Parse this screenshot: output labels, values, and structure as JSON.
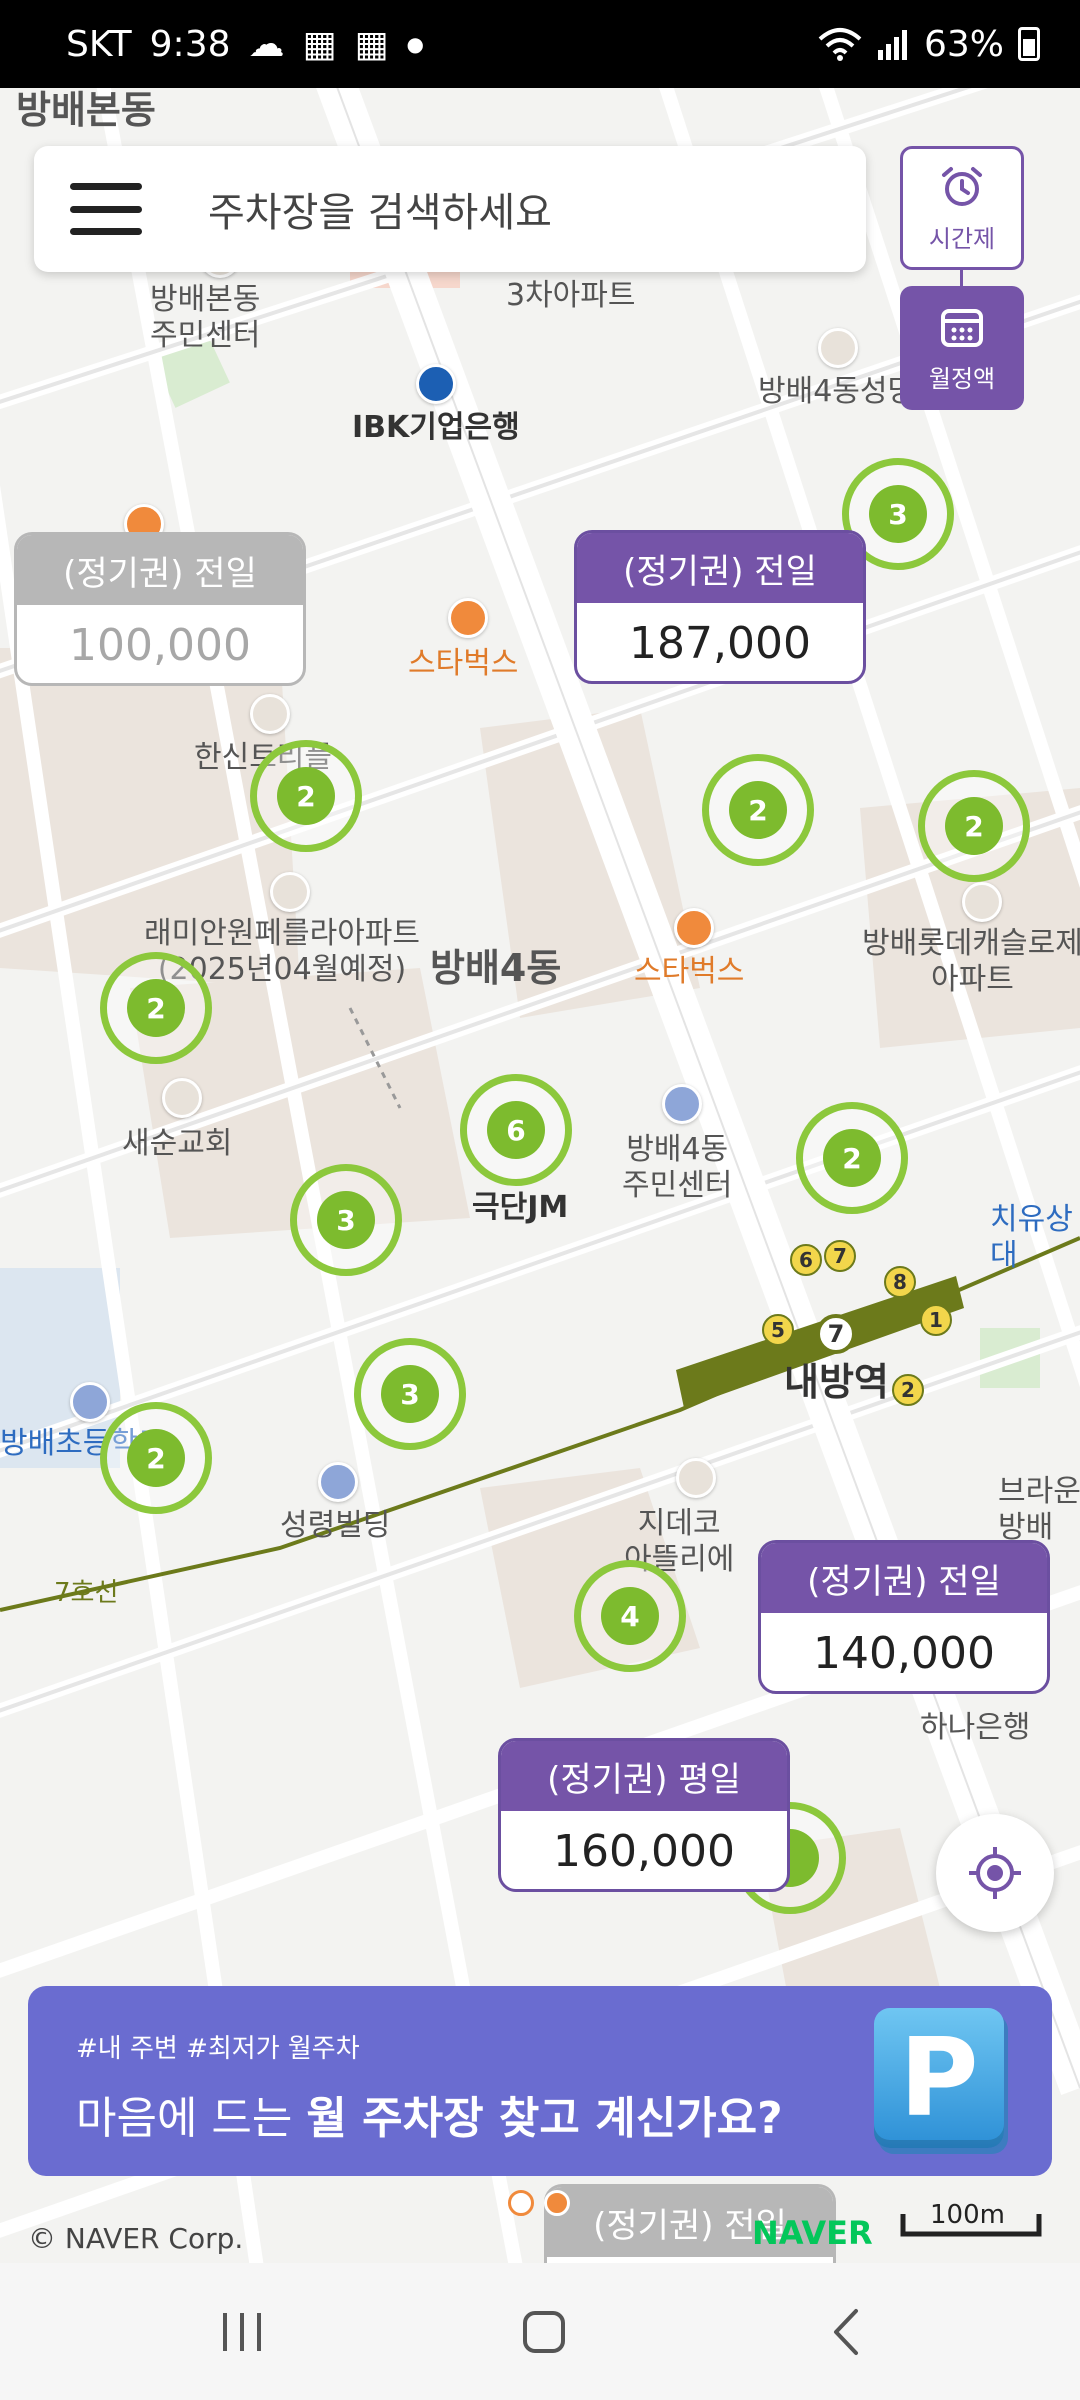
{
  "status_bar": {
    "carrier": "SKT",
    "time": "9:38",
    "battery": "63%"
  },
  "search": {
    "placeholder": "주차장을 검색하세요"
  },
  "mode_buttons": {
    "hourly_label": "시간제",
    "monthly_label": "월정액"
  },
  "map_labels": {
    "area_top": "방배본동",
    "center_top": "방배본동\n주민센터",
    "apt3": "3차아파트",
    "ibk": "IBK기업은행",
    "bangbae4_sung": "방배4동성당",
    "starbucks1": "스타벅스",
    "starbucks2": "스타벅스",
    "hansin": "한신트리플",
    "raemian": "래미안원페를라아파트\n(2025년04월예정)",
    "bangbae4": "방배4동",
    "lotte": "방배롯데캐슬로제\n아파트",
    "saesoon": "새순교회",
    "gukdan": "극단JM",
    "center4": "방배4동\n주민센터",
    "naebang": "내방역",
    "school": "방배초등학교",
    "seongnyeong": "성령빌딩",
    "line7": "7호선",
    "jideco": "지데코\n아뜰리에",
    "hana": "하나은행",
    "chiyu": "치유상\n대",
    "brown": "브라운\n방배"
  },
  "clusters": [
    {
      "count": "3"
    },
    {
      "count": "2"
    },
    {
      "count": "2"
    },
    {
      "count": "2"
    },
    {
      "count": "2"
    },
    {
      "count": "6"
    },
    {
      "count": "2"
    },
    {
      "count": "3"
    },
    {
      "count": "3"
    },
    {
      "count": "2"
    },
    {
      "count": "4"
    }
  ],
  "price_markers": [
    {
      "type": "(정기권) 전일",
      "price": "100,000",
      "selected": false
    },
    {
      "type": "(정기권) 전일",
      "price": "187,000",
      "selected": true
    },
    {
      "type": "(정기권) 전일",
      "price": "140,000",
      "selected": true
    },
    {
      "type": "(정기권) 평일",
      "price": "160,000",
      "selected": true
    },
    {
      "type": "(정기권) 전일",
      "price": "",
      "selected": false
    }
  ],
  "subway_exits": [
    "6",
    "7",
    "8",
    "5",
    "7",
    "1",
    "2"
  ],
  "banner": {
    "tag": "#내 주변 #최저가 월주차",
    "headline_prefix": "마음에 드는 ",
    "headline_strong": "월 주차장 찾고 계신가요?",
    "icon_letter": "P"
  },
  "map_footer": {
    "copyright": "© NAVER Corp.",
    "logo": "NAVER",
    "scale": "100m"
  },
  "colors": {
    "accent_purple": "#7554a8",
    "cluster_green": "#7dbb2e",
    "banner_blue": "#6a6cd0"
  }
}
